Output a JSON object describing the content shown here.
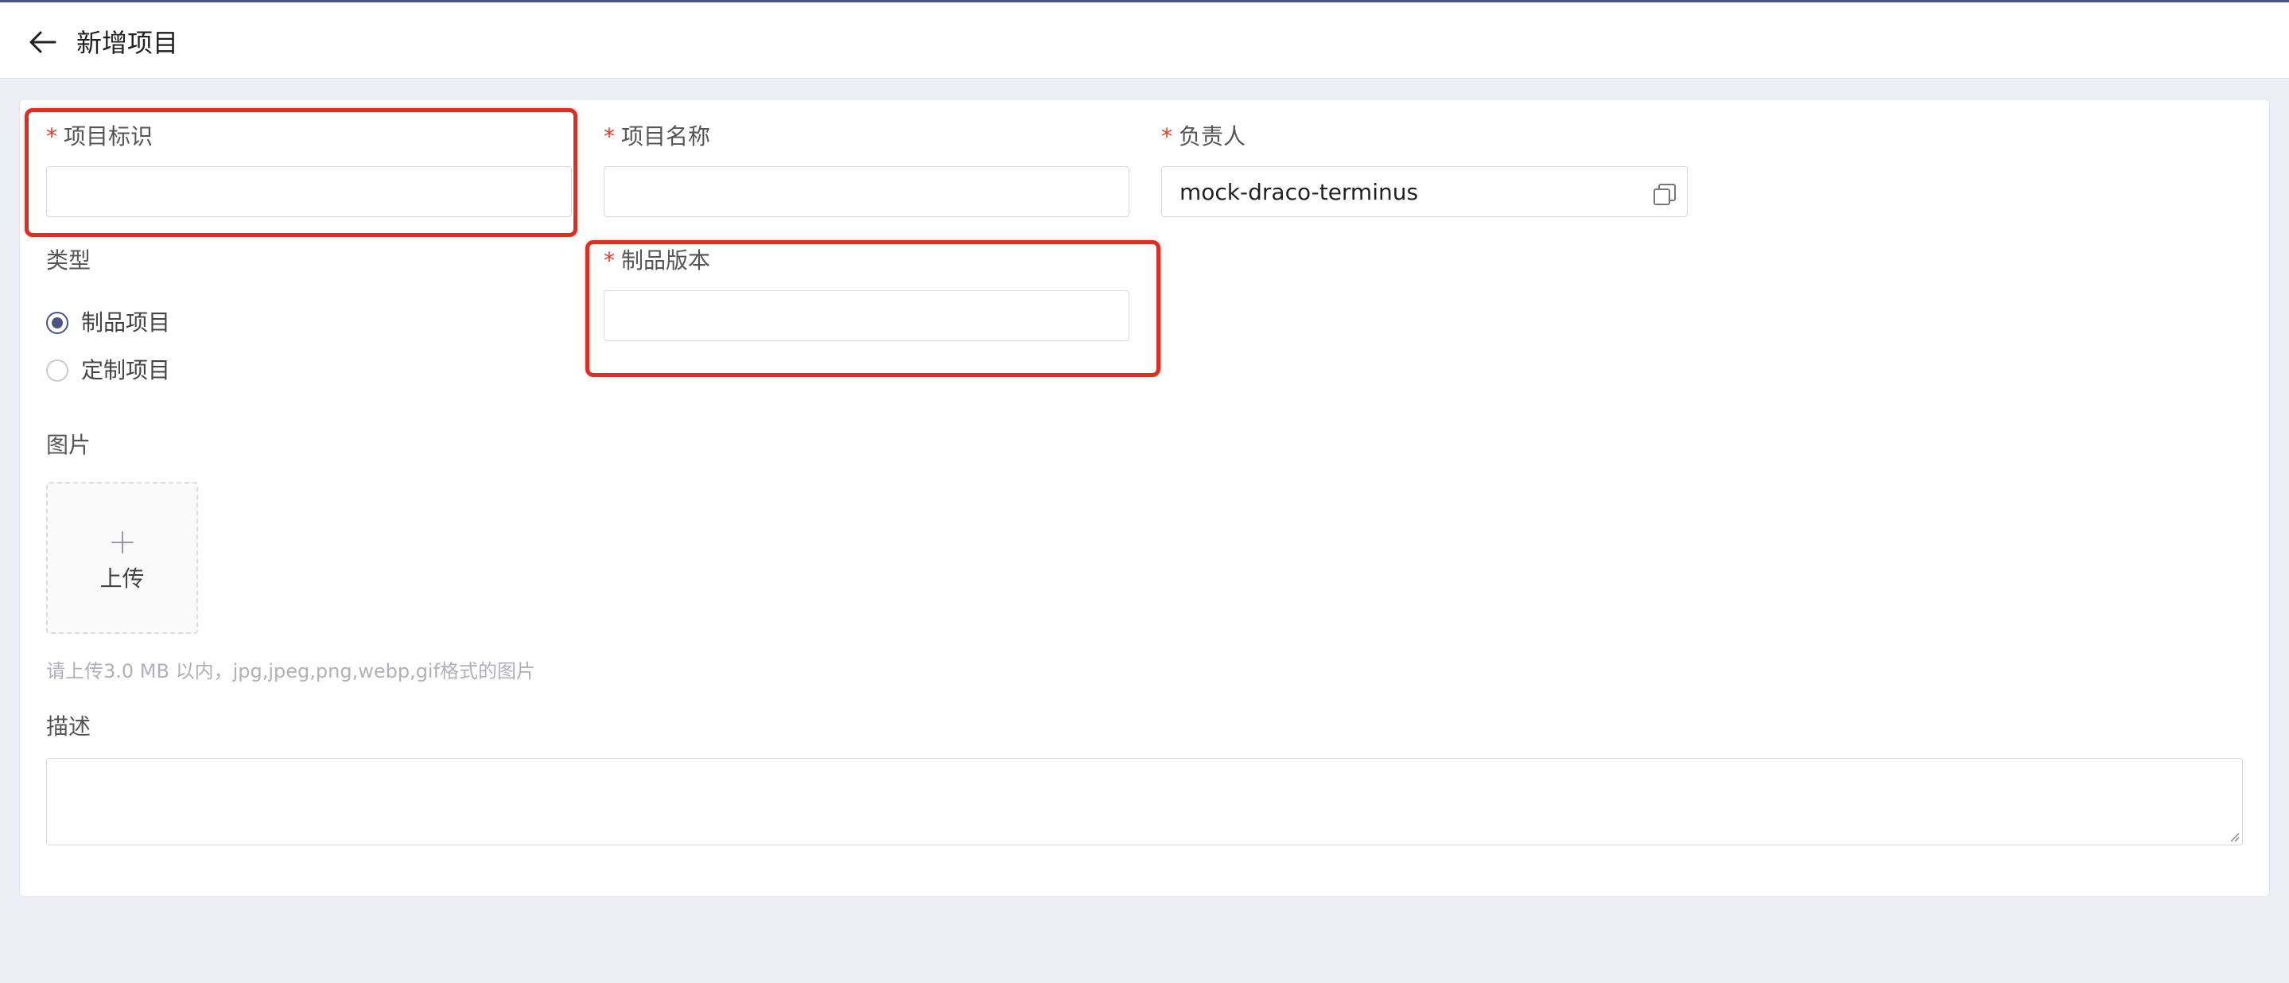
{
  "header": {
    "title": "新增项目"
  },
  "form": {
    "required_mark": "*",
    "project_id": {
      "label": "项目标识",
      "value": "",
      "placeholder": ""
    },
    "project_name": {
      "label": "项目名称",
      "value": "",
      "placeholder": ""
    },
    "owner": {
      "label": "负责人",
      "value": "mock-draco-terminus"
    },
    "type": {
      "label": "类型",
      "options": [
        {
          "label": "制品项目",
          "checked": true
        },
        {
          "label": "定制项目",
          "checked": false
        }
      ]
    },
    "product_version": {
      "label": "制品版本",
      "value": "",
      "placeholder": ""
    },
    "image": {
      "label": "图片",
      "upload_label": "上传",
      "hint": "请上传3.0 MB 以内，jpg,jpeg,png,webp,gif格式的图片"
    },
    "description": {
      "label": "描述",
      "value": ""
    }
  },
  "icons": {
    "back": "arrow-left-icon",
    "owner_picker": "copy-icon",
    "upload": "plus-icon"
  },
  "colors": {
    "accent": "#4b5583",
    "required": "#e03a2f",
    "highlight": "#d93025",
    "page_bg": "#eeeff6"
  }
}
